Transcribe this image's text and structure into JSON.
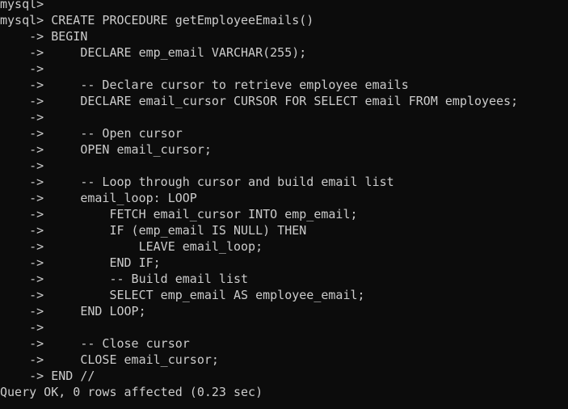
{
  "terminal": {
    "text_color": "#cccccc",
    "background": "#0c0c0c",
    "lines": [
      {
        "prompt": "mysql> ",
        "code": ""
      },
      {
        "prompt": "mysql> ",
        "code": "CREATE PROCEDURE getEmployeeEmails()"
      },
      {
        "prompt": "    -> ",
        "code": "BEGIN"
      },
      {
        "prompt": "    -> ",
        "code": "    DECLARE emp_email VARCHAR(255);"
      },
      {
        "prompt": "    -> ",
        "code": ""
      },
      {
        "prompt": "    -> ",
        "code": "    -- Declare cursor to retrieve employee emails"
      },
      {
        "prompt": "    -> ",
        "code": "    DECLARE email_cursor CURSOR FOR SELECT email FROM employees;"
      },
      {
        "prompt": "    -> ",
        "code": ""
      },
      {
        "prompt": "    -> ",
        "code": "    -- Open cursor"
      },
      {
        "prompt": "    -> ",
        "code": "    OPEN email_cursor;"
      },
      {
        "prompt": "    -> ",
        "code": ""
      },
      {
        "prompt": "    -> ",
        "code": "    -- Loop through cursor and build email list"
      },
      {
        "prompt": "    -> ",
        "code": "    email_loop: LOOP"
      },
      {
        "prompt": "    -> ",
        "code": "        FETCH email_cursor INTO emp_email;"
      },
      {
        "prompt": "    -> ",
        "code": "        IF (emp_email IS NULL) THEN"
      },
      {
        "prompt": "    -> ",
        "code": "            LEAVE email_loop;"
      },
      {
        "prompt": "    -> ",
        "code": "        END IF;"
      },
      {
        "prompt": "    -> ",
        "code": "        -- Build email list"
      },
      {
        "prompt": "    -> ",
        "code": "        SELECT emp_email AS employee_email;"
      },
      {
        "prompt": "    -> ",
        "code": "    END LOOP;"
      },
      {
        "prompt": "    -> ",
        "code": ""
      },
      {
        "prompt": "    -> ",
        "code": "    -- Close cursor"
      },
      {
        "prompt": "    -> ",
        "code": "    CLOSE email_cursor;"
      },
      {
        "prompt": "    -> ",
        "code": "END //"
      }
    ],
    "result": "Query OK, 0 rows affected (0.23 sec)"
  }
}
